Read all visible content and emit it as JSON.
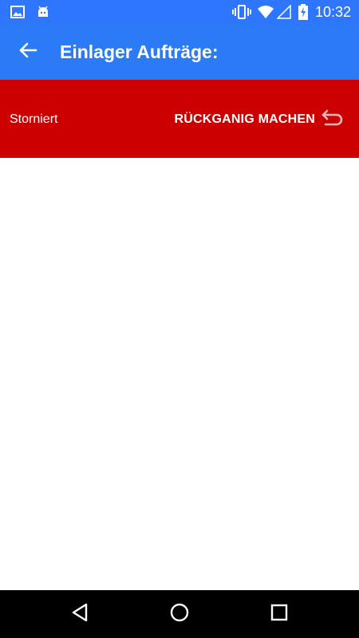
{
  "status_bar": {
    "time": "10:32",
    "icons": [
      "image-icon",
      "android-icon",
      "vibrate-icon",
      "wifi-icon",
      "cell-signal-icon",
      "battery-charging-icon"
    ]
  },
  "app_bar": {
    "title": "Einlager Aufträge:",
    "back_icon": "arrow-back-icon",
    "color": "#2b7bf6"
  },
  "banner": {
    "status": "Storniert",
    "action_label": "RÜCKGANIG MACHEN",
    "action_icon": "undo-icon",
    "color": "#cc0000"
  },
  "nav_bar": {
    "buttons": [
      "back-triangle-icon",
      "home-circle-icon",
      "recents-square-icon"
    ]
  }
}
